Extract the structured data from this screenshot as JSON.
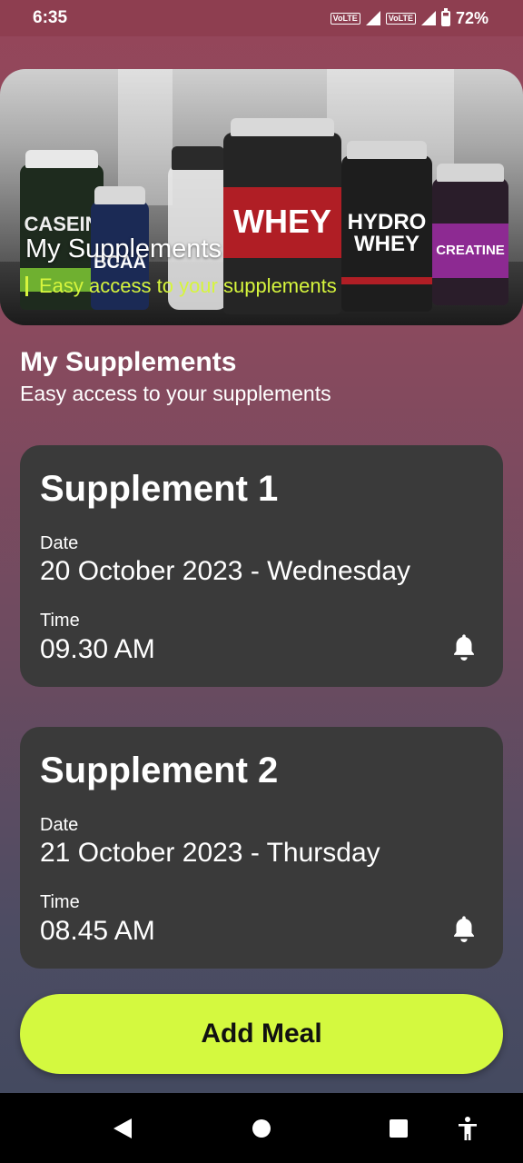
{
  "status_bar": {
    "time": "6:35",
    "network_1": "VoLTE",
    "network_1_type": "4G",
    "network_2": "VoLTE",
    "battery": "72%"
  },
  "hero": {
    "title": "My Supplements",
    "subtitle": "Easy access to your supplements",
    "products": [
      "CASEIN",
      "BCAA",
      "WHEY",
      "HYDRO WHEY",
      "CREATINE"
    ]
  },
  "section": {
    "title": "My Supplements",
    "subtitle": "Easy access to your supplements"
  },
  "supplements": [
    {
      "name": "Supplement 1",
      "date_label": "Date",
      "date": "20 October 2023 - Wednesday",
      "time_label": "Time",
      "time": "09.30 AM"
    },
    {
      "name": "Supplement 2",
      "date_label": "Date",
      "date": "21 October 2023 - Thursday",
      "time_label": "Time",
      "time": "08.45 AM"
    }
  ],
  "add_button_label": "Add Meal",
  "colors": {
    "accent": "#d4f93f",
    "card": "#3a3a3a",
    "subtitle_accent": "#d6f53d"
  },
  "icons": [
    "bell-icon",
    "back-icon",
    "home-icon",
    "recents-icon",
    "accessibility-icon"
  ]
}
